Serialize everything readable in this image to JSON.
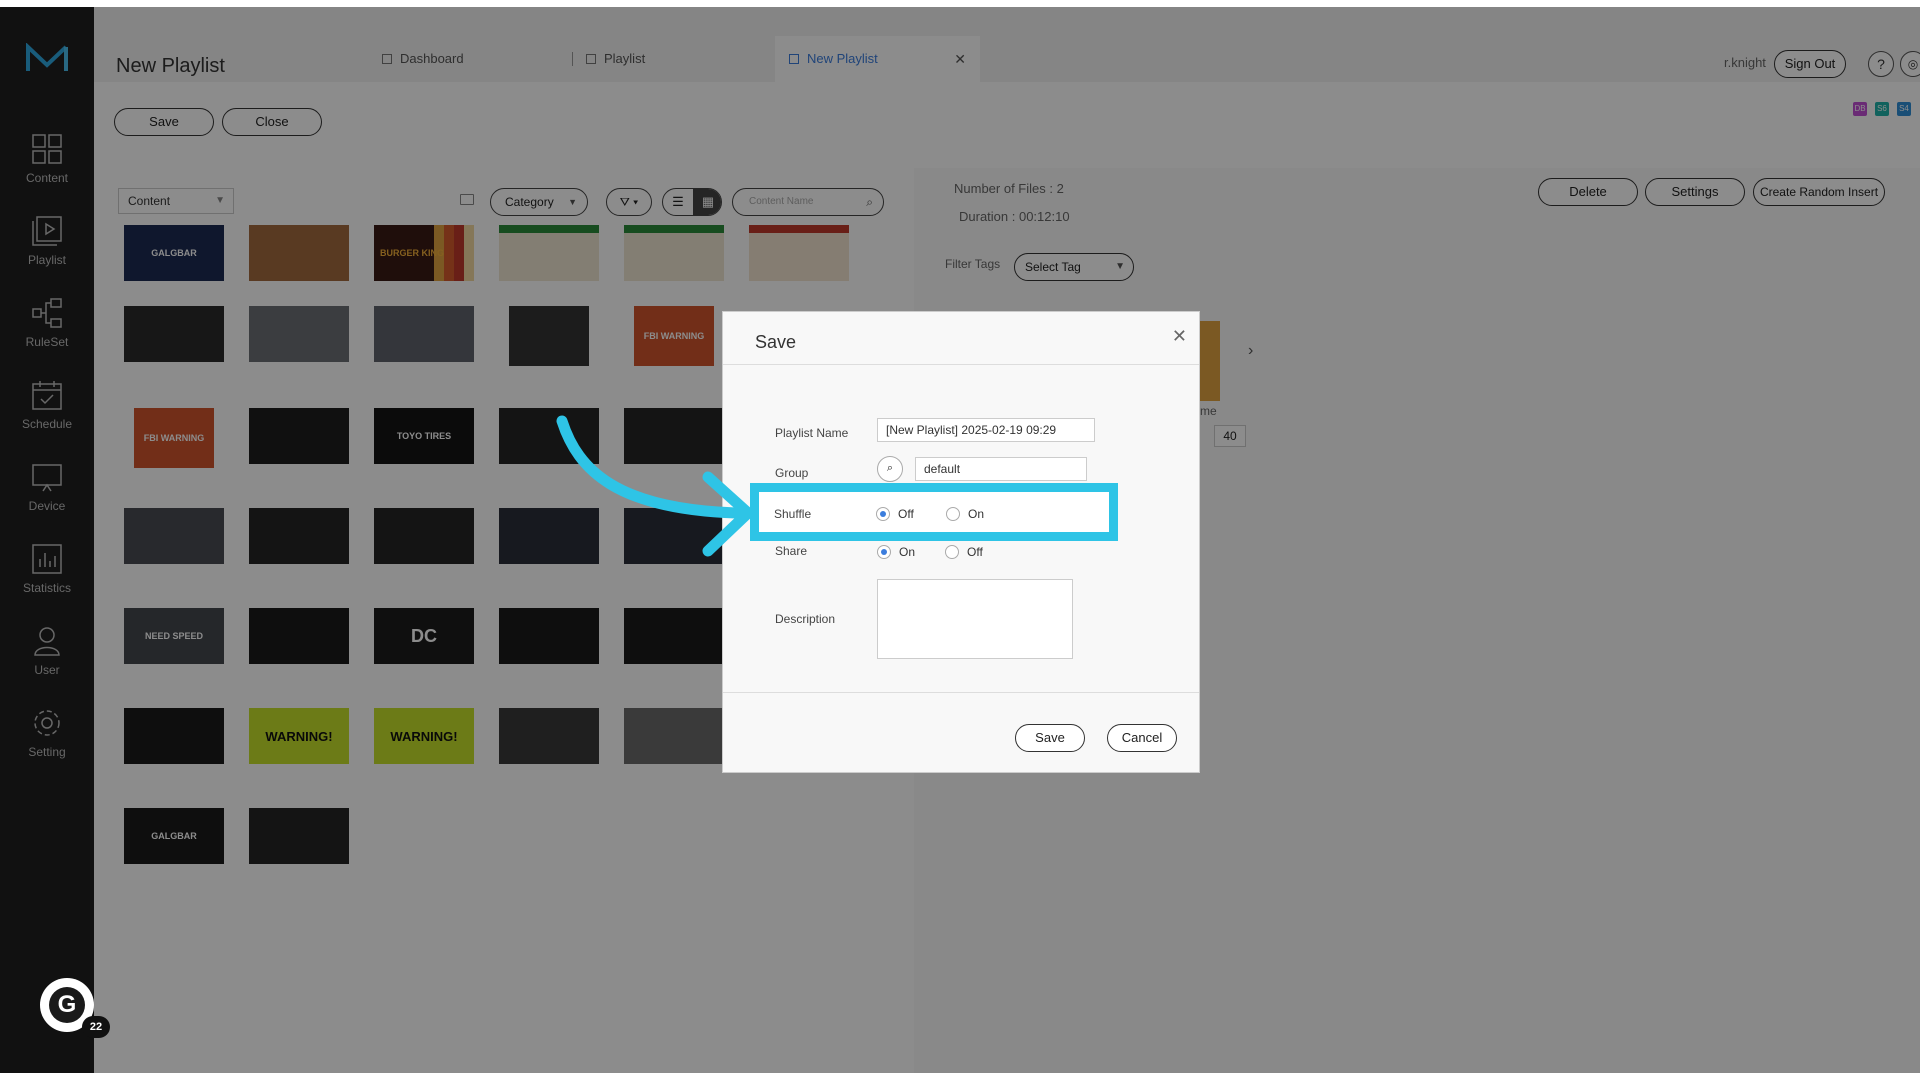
{
  "app": {
    "page_title": "New Playlist",
    "tabs": [
      {
        "label": "Dashboard",
        "icon": "grid-icon"
      },
      {
        "label": "Playlist",
        "icon": "playlist-icon"
      },
      {
        "label": "New Playlist",
        "icon": "playlist-icon",
        "active": true
      }
    ],
    "user": "r.knight",
    "sign_out": "Sign Out",
    "help": "?"
  },
  "sidebar": {
    "items": [
      {
        "label": "Content",
        "icon": "content-icon"
      },
      {
        "label": "Playlist",
        "icon": "playlist-icon"
      },
      {
        "label": "RuleSet",
        "icon": "ruleset-icon"
      },
      {
        "label": "Schedule",
        "icon": "schedule-icon"
      },
      {
        "label": "Device",
        "icon": "device-icon"
      },
      {
        "label": "Statistics",
        "icon": "statistics-icon"
      },
      {
        "label": "User",
        "icon": "user-icon"
      },
      {
        "label": "Setting",
        "icon": "setting-icon"
      }
    ],
    "grammarly_count": "22"
  },
  "toolbar": {
    "save": "Save",
    "close": "Close",
    "badges": [
      {
        "text": "DB",
        "color": "#c24fd6"
      },
      {
        "text": "S6",
        "color": "#1fb3a9"
      },
      {
        "text": "S4",
        "color": "#2f8fd8"
      }
    ]
  },
  "content_panel": {
    "content_select": "Content",
    "category": "Category",
    "search_placeholder": "Content Name",
    "thumb_labels": {
      "burger": "BURGER KING",
      "warning": "WARNING!",
      "fbi": "FBI WARNING",
      "toyo": "TOYO TIRES",
      "galgbar": "GALGBAR",
      "need": "NEED SPEED"
    }
  },
  "right_panel": {
    "file_count": "Number of Files : 2",
    "duration": "Duration : 00:12:10",
    "filter_tags_label": "Filter Tags",
    "select_tag": "Select Tag",
    "delete": "Delete",
    "settings": "Settings",
    "create_random_insert": "Create Random Insert",
    "partial_name": "me",
    "time_value": "40"
  },
  "dialog": {
    "title": "Save",
    "playlist_name_label": "Playlist Name",
    "playlist_name_value": "[New Playlist] 2025-02-19 09:29",
    "group_label": "Group",
    "group_value": "default",
    "shuffle_label": "Shuffle",
    "shuffle_off": "Off",
    "shuffle_on": "On",
    "shuffle_selected": "Off",
    "share_label": "Share",
    "share_on": "On",
    "share_off": "Off",
    "share_selected": "On",
    "description_label": "Description",
    "save": "Save",
    "cancel": "Cancel"
  },
  "highlight": {
    "color": "#2ec4e6",
    "target": "shuffle-row"
  }
}
